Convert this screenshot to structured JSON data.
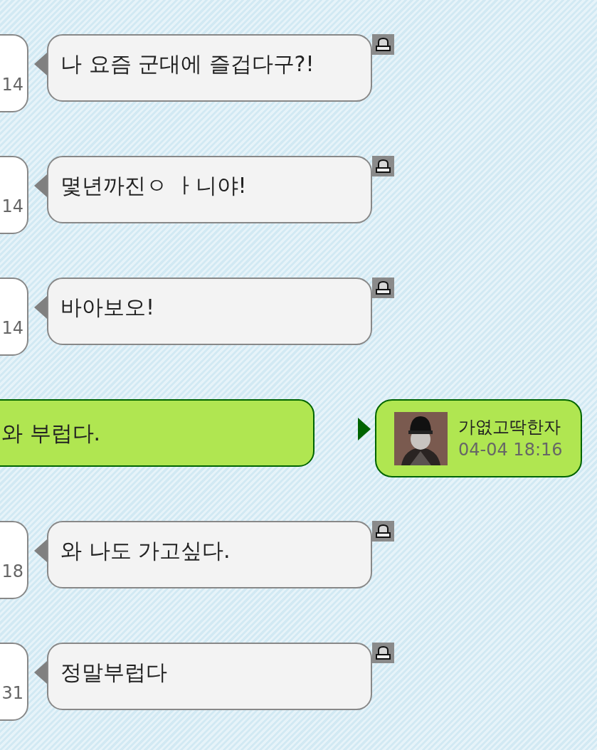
{
  "messages": [
    {
      "kind": "incoming",
      "time": "14",
      "text": "나 요즘 군대에 즐겁다구?!"
    },
    {
      "kind": "incoming",
      "time": "14",
      "text": "몇년까진ㅇ ㅏ니야!"
    },
    {
      "kind": "incoming",
      "time": "14",
      "text": "바아보오!"
    },
    {
      "kind": "outgoing",
      "text": "와 부럽다.",
      "sender": "가엾고딱한자",
      "time": "04-04 18:16"
    },
    {
      "kind": "incoming",
      "time": "18",
      "text": "와 나도 가고싶다."
    },
    {
      "kind": "incoming",
      "time": "31",
      "text": "정말부럽다"
    }
  ]
}
